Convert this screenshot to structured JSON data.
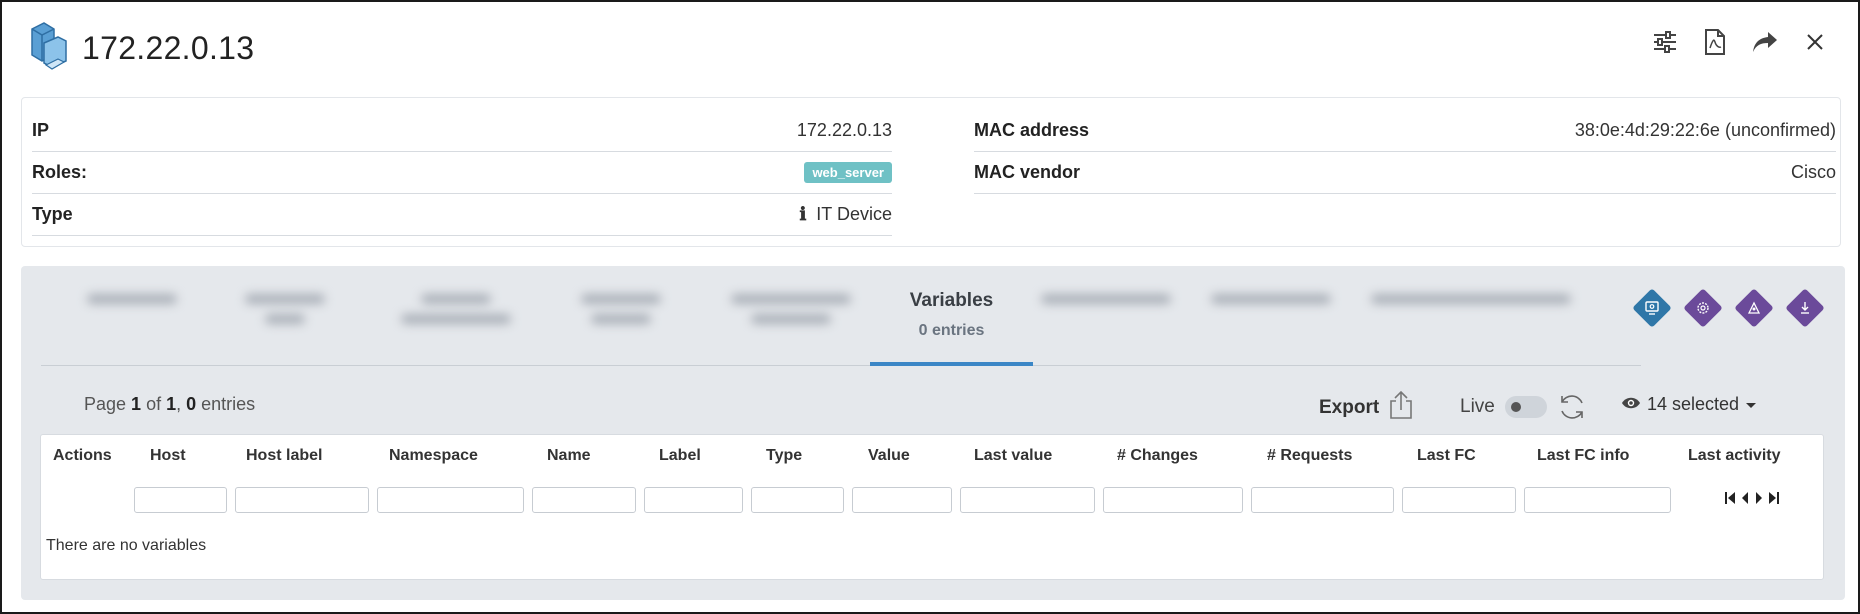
{
  "header": {
    "title": "172.22.0.13",
    "device_icon": "network-device-icon",
    "actions": [
      "filters-icon",
      "pdf-icon",
      "share-icon",
      "close-icon"
    ]
  },
  "info": {
    "left": [
      {
        "label": "IP",
        "value": "172.22.0.13"
      },
      {
        "label": "Roles:",
        "badge": "web_server"
      },
      {
        "label": "Type",
        "icon": "info-icon",
        "value": "IT Device"
      }
    ],
    "right": [
      {
        "label": "MAC address",
        "value": "38:0e:4d:29:22:6e (unconfirmed)"
      },
      {
        "label": "MAC vendor",
        "value": "Cisco"
      }
    ]
  },
  "tabs": {
    "active": {
      "label": "Variables",
      "sub": "0 entries"
    }
  },
  "toolbar": {
    "page_prefix": "Page ",
    "page_current": "1",
    "page_of": " of ",
    "page_total": "1",
    "page_sep": ", ",
    "entries_count": "0",
    "entries_suffix": " entries",
    "export_label": "Export",
    "live_label": "Live",
    "selected_label": "14 selected"
  },
  "table": {
    "columns": [
      "Actions",
      "Host",
      "Host label",
      "Namespace",
      "Name",
      "Label",
      "Type",
      "Value",
      "Last value",
      "# Changes",
      "# Requests",
      "Last FC",
      "Last FC info",
      "Last activity"
    ],
    "empty_text": "There are no variables"
  },
  "colors": {
    "accent": "#3b86c6",
    "badge": "#6fc1c5",
    "diamond_blue": "#2f77a8",
    "diamond_purple": "#6b4a9a"
  }
}
